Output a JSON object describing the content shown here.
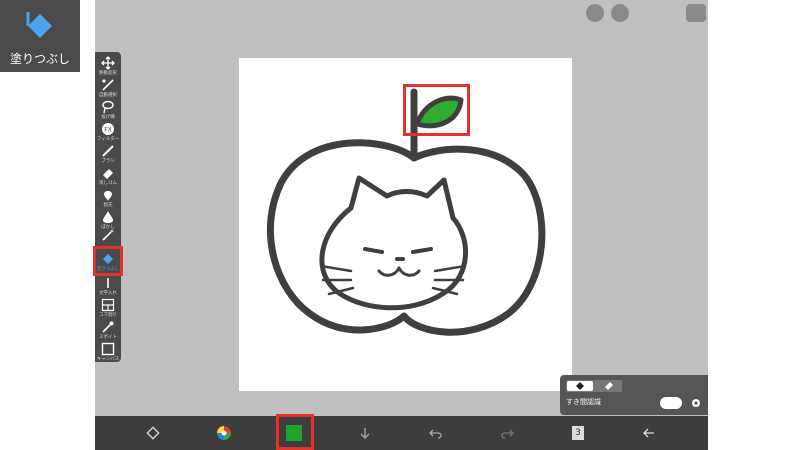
{
  "tool_badge": {
    "label": "塗りつぶし",
    "icon": "fill-bucket-icon",
    "color": "#4aa3f0"
  },
  "toolbar": {
    "items": [
      {
        "id": "move",
        "label": "移動変形"
      },
      {
        "id": "auto-select",
        "label": "自動選択"
      },
      {
        "id": "lasso",
        "label": "投げ縄"
      },
      {
        "id": "filter",
        "label": "フィルター"
      },
      {
        "id": "brush",
        "label": "ブラシ"
      },
      {
        "id": "eraser",
        "label": "消しゴム"
      },
      {
        "id": "smudge",
        "label": "指先"
      },
      {
        "id": "blur",
        "label": "ぼかし"
      },
      {
        "id": "magic-wand",
        "label": ""
      },
      {
        "id": "fill",
        "label": "塗りつぶし",
        "selected": true
      },
      {
        "id": "text",
        "label": "文字入れ"
      },
      {
        "id": "frame",
        "label": "コマ割り"
      },
      {
        "id": "eyedropper",
        "label": "スポイト"
      },
      {
        "id": "canvas",
        "label": "キャンバス"
      }
    ]
  },
  "fill_panel": {
    "option_label": "すき間認識",
    "toggle_on": true
  },
  "bottom_bar": {
    "current_color": "#1fa22e",
    "layer_count": "3"
  },
  "colors": {
    "highlight": "#e5312b",
    "stroke": "#3f3f3f",
    "leaf": "#2eae2e"
  }
}
